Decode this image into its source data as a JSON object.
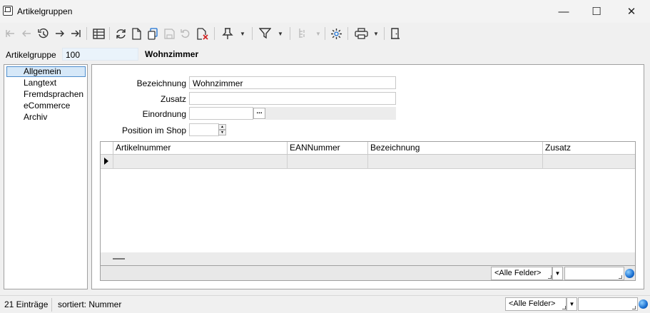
{
  "window": {
    "title": "Artikelgruppen",
    "controls": {
      "minimize": "—",
      "maximize": "☐",
      "close": "✕"
    }
  },
  "header": {
    "group_label": "Artikelgruppe",
    "group_value": "100",
    "group_name": "Wohnzimmer"
  },
  "nav": {
    "items": [
      {
        "label": "Allgemein",
        "selected": true
      },
      {
        "label": "Langtext"
      },
      {
        "label": "Fremdsprachen"
      },
      {
        "label": "eCommerce"
      },
      {
        "label": "Archiv"
      }
    ]
  },
  "form": {
    "bezeichnung_label": "Bezeichnung",
    "bezeichnung_value": "Wohnzimmer",
    "zusatz_label": "Zusatz",
    "zusatz_value": "",
    "einordnung_label": "Einordnung",
    "einordnung_button": "...",
    "position_label": "Position im Shop",
    "position_value": ""
  },
  "grid": {
    "columns": [
      "Artikelnummer",
      "EANNummer",
      "Bezeichnung",
      "Zusatz"
    ],
    "filter_value": "<Alle Felder>",
    "search_value": ""
  },
  "status": {
    "count": "21 Einträge",
    "sort": "sortiert: Nummer",
    "filter_value": "<Alle Felder>",
    "search_value": ""
  },
  "icons": {
    "first": "first-record-icon",
    "prev": "previous-record-icon",
    "history": "history-icon",
    "next": "next-record-icon",
    "last": "last-record-icon",
    "table": "table-view-icon",
    "refresh": "refresh-icon",
    "new": "new-record-icon",
    "copy": "copy-icon",
    "save": "save-icon",
    "undo": "undo-icon",
    "delete": "delete-icon",
    "pin": "pin-icon",
    "filter": "filter-icon",
    "tree": "tree-view-icon",
    "settings": "settings-icon",
    "print": "print-icon",
    "exit": "exit-icon"
  },
  "colors": {
    "selection": "#d6e8f8",
    "selection_border": "#4d8dcc",
    "key_field": "#eaf3fb"
  }
}
